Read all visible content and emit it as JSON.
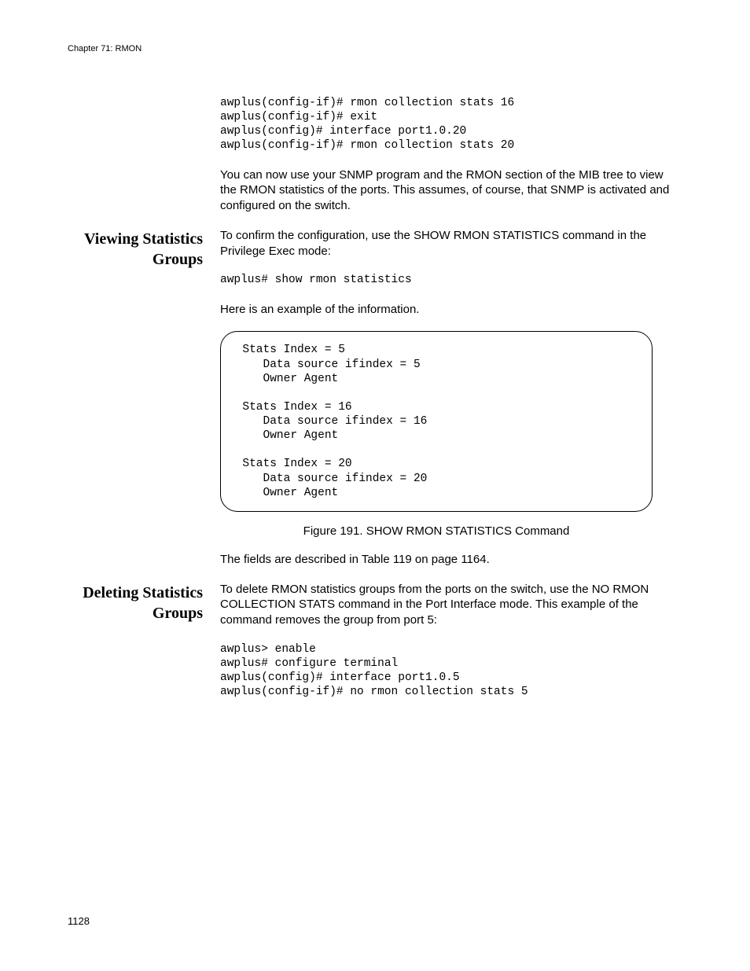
{
  "header": {
    "chapter": "Chapter 71: RMON"
  },
  "intro": {
    "code": "awplus(config-if)# rmon collection stats 16\nawplus(config-if)# exit\nawplus(config)# interface port1.0.20\nawplus(config-if)# rmon collection stats 20",
    "paragraph": "You can now use your SNMP program and the RMON section of the MIB tree to view the RMON statistics of the ports. This assumes, of course, that SNMP is activated and configured on the switch."
  },
  "viewing": {
    "heading": "Viewing Statistics Groups",
    "p1": "To confirm the configuration, use the SHOW RMON STATISTICS command in the Privilege Exec mode:",
    "code1": "awplus# show rmon statistics",
    "p2": "Here is an example of the information.",
    "output": "  Stats Index = 5\n     Data source ifindex = 5\n     Owner Agent\n\n  Stats Index = 16\n     Data source ifindex = 16\n     Owner Agent\n\n  Stats Index = 20\n     Data source ifindex = 20\n     Owner Agent",
    "figcaption": "Figure 191. SHOW RMON STATISTICS Command",
    "p3": "The fields are described in Table 119 on page 1164."
  },
  "deleting": {
    "heading": "Deleting Statistics Groups",
    "p1": "To delete RMON statistics groups from the ports on the switch, use the NO RMON COLLECTION STATS command in the Port Interface mode. This example of the command removes the group from port 5:",
    "code1": "awplus> enable\nawplus# configure terminal\nawplus(config)# interface port1.0.5\nawplus(config-if)# no rmon collection stats 5"
  },
  "footer": {
    "page_number": "1128"
  }
}
